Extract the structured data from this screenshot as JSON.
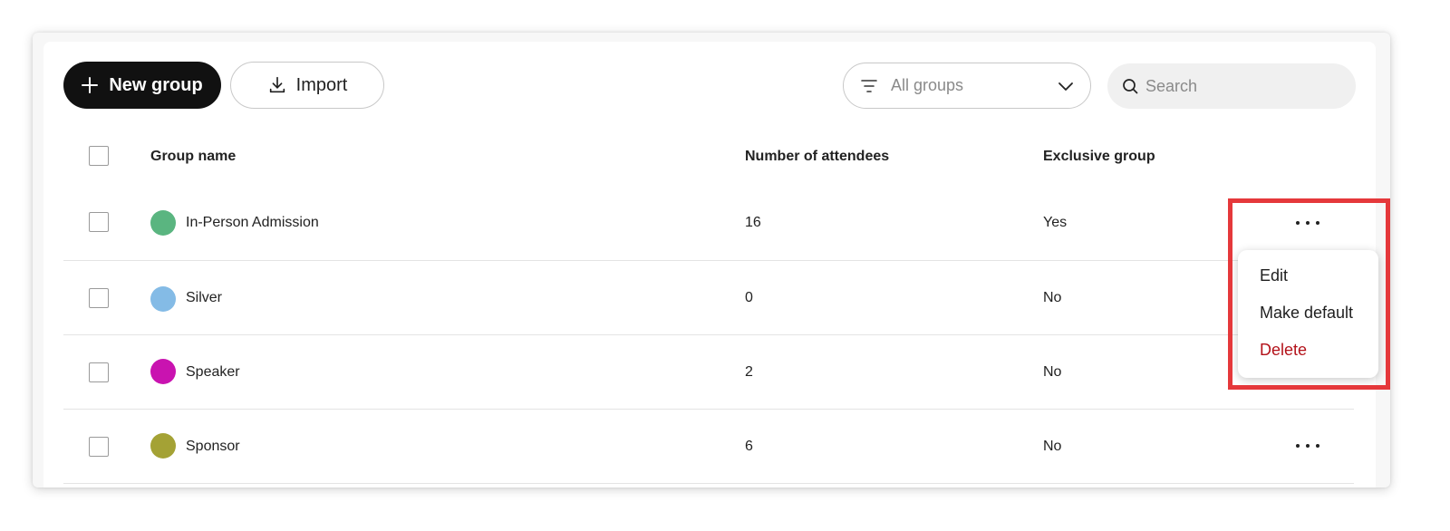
{
  "toolbar": {
    "new_group_label": "New group",
    "import_label": "Import",
    "filter_value": "All groups",
    "search_placeholder": "Search"
  },
  "table": {
    "columns": [
      "Group name",
      "Number of attendees",
      "Exclusive group"
    ],
    "rows": [
      {
        "name": "In-Person Admission",
        "attendees": "16",
        "exclusive": "Yes",
        "color": "#5ab580"
      },
      {
        "name": "Silver",
        "attendees": "0",
        "exclusive": "No",
        "color": "#84bbe6"
      },
      {
        "name": "Speaker",
        "attendees": "2",
        "exclusive": "No",
        "color": "#c913b0"
      },
      {
        "name": "Sponsor",
        "attendees": "6",
        "exclusive": "No",
        "color": "#a4a235"
      }
    ]
  },
  "row_menu": {
    "items": [
      "Edit",
      "Make default",
      "Delete"
    ],
    "danger_color": "#b3121a"
  },
  "colors": {
    "primary_button": "#111111",
    "highlight": "#e5383b"
  }
}
